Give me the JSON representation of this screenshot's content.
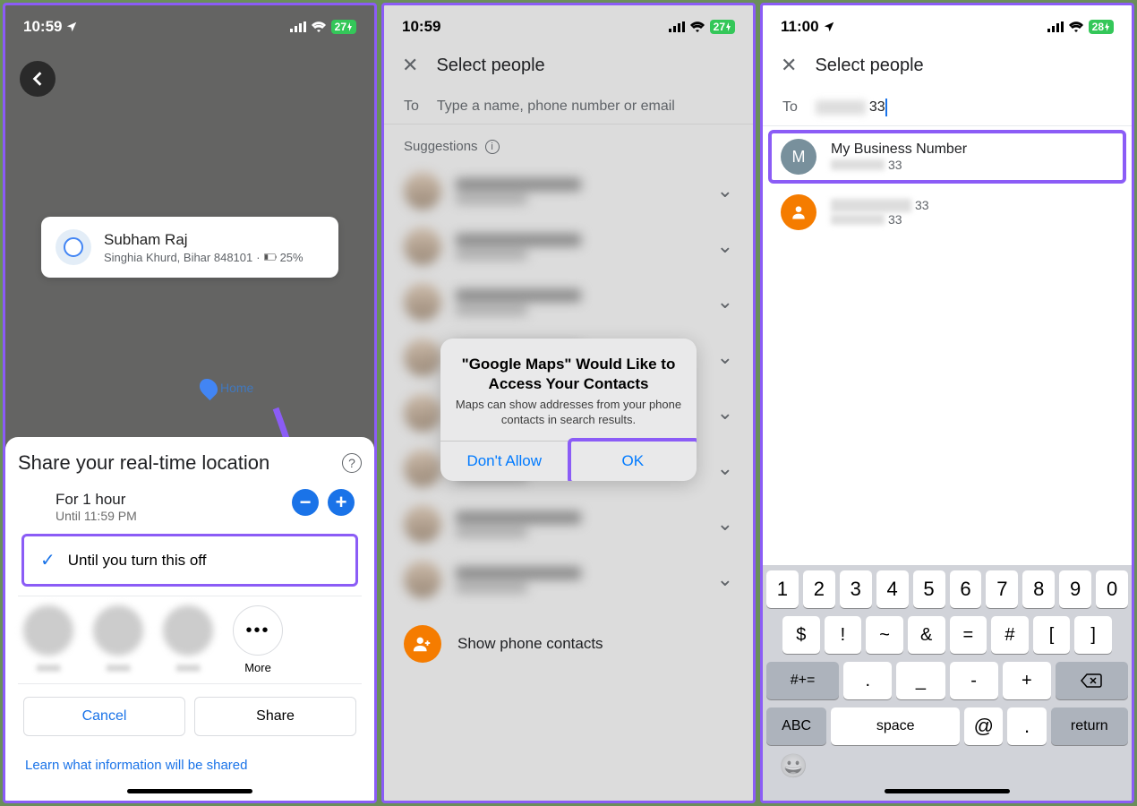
{
  "p1": {
    "time": "10:59",
    "battery": "27",
    "loc_name": "Subham Raj",
    "loc_addr": "Singhia Khurd, Bihar 848101",
    "loc_batt": "25%",
    "home_label": "Home",
    "sheet_title": "Share your real-time location",
    "opt1_title": "For 1 hour",
    "opt1_sub": "Until 11:59 PM",
    "opt2_title": "Until you turn this off",
    "more_label": "More",
    "cancel": "Cancel",
    "share": "Share",
    "learn": "Learn what information will be shared"
  },
  "p2": {
    "time": "10:59",
    "battery": "27",
    "title": "Select people",
    "to_label": "To",
    "to_placeholder": "Type a name, phone number or email",
    "suggestions": "Suggestions",
    "show_contacts": "Show phone contacts",
    "dialog_title": "\"Google Maps\" Would Like to Access Your Contacts",
    "dialog_msg": "Maps can show addresses from your phone contacts in search results.",
    "dont_allow": "Don't Allow",
    "ok": "OK"
  },
  "p3": {
    "time": "11:00",
    "battery": "28",
    "title": "Select people",
    "to_label": "To",
    "to_value": "33",
    "result1_name": "My Business Number",
    "result1_sub": "33",
    "result2_sub": "33",
    "kb_row1": [
      "1",
      "2",
      "3",
      "4",
      "5",
      "6",
      "7",
      "8",
      "9",
      "0"
    ],
    "kb_row2": [
      "$",
      "!",
      "~",
      "&",
      "=",
      "#",
      "[",
      "]"
    ],
    "kb_row3_shift": "#+=",
    "kb_row3": [
      ".",
      "_",
      "-",
      "+"
    ],
    "kb_abc": "ABC",
    "kb_space": "space",
    "kb_at": "@",
    "kb_dot": ".",
    "kb_return": "return"
  }
}
